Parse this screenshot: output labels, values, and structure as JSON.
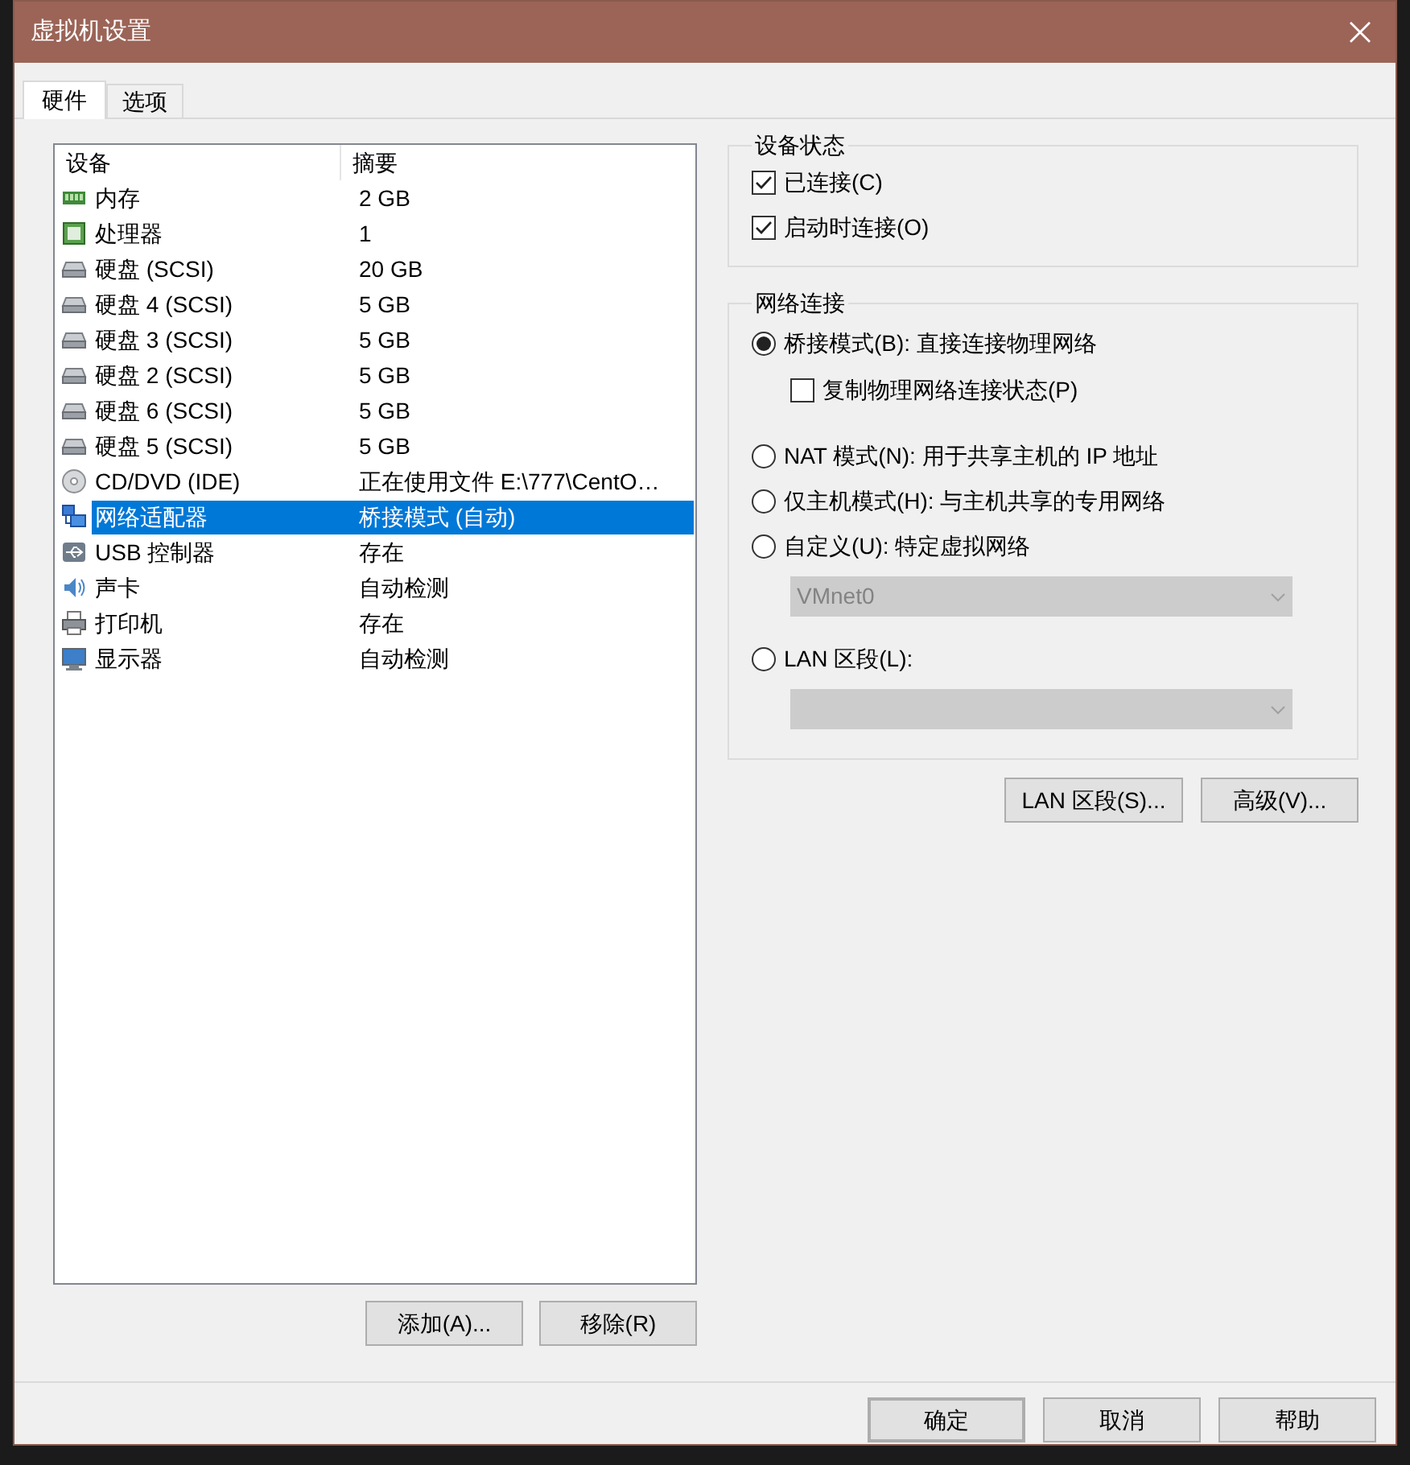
{
  "window": {
    "title": "虚拟机设置"
  },
  "tabs": [
    {
      "label": "硬件",
      "selected": true
    },
    {
      "label": "选项",
      "selected": false
    }
  ],
  "device_table": {
    "columns": [
      "设备",
      "摘要"
    ],
    "rows": [
      {
        "kind": "memory",
        "device": "内存",
        "summary": "2 GB",
        "selected": false
      },
      {
        "kind": "cpu",
        "device": "处理器",
        "summary": "1",
        "selected": false
      },
      {
        "kind": "disk",
        "device": "硬盘 (SCSI)",
        "summary": "20 GB",
        "selected": false
      },
      {
        "kind": "disk",
        "device": "硬盘 4 (SCSI)",
        "summary": "5 GB",
        "selected": false
      },
      {
        "kind": "disk",
        "device": "硬盘 3 (SCSI)",
        "summary": "5 GB",
        "selected": false
      },
      {
        "kind": "disk",
        "device": "硬盘 2 (SCSI)",
        "summary": "5 GB",
        "selected": false
      },
      {
        "kind": "disk",
        "device": "硬盘 6 (SCSI)",
        "summary": "5 GB",
        "selected": false
      },
      {
        "kind": "disk",
        "device": "硬盘 5 (SCSI)",
        "summary": "5 GB",
        "selected": false
      },
      {
        "kind": "cd",
        "device": "CD/DVD (IDE)",
        "summary": "正在使用文件 E:\\777\\CentO…",
        "selected": false
      },
      {
        "kind": "network",
        "device": "网络适配器",
        "summary": "桥接模式 (自动)",
        "selected": true
      },
      {
        "kind": "usb",
        "device": "USB 控制器",
        "summary": "存在",
        "selected": false
      },
      {
        "kind": "sound",
        "device": "声卡",
        "summary": "自动检测",
        "selected": false
      },
      {
        "kind": "printer",
        "device": "打印机",
        "summary": "存在",
        "selected": false
      },
      {
        "kind": "monitor",
        "device": "显示器",
        "summary": "自动检测",
        "selected": false
      }
    ]
  },
  "list_buttons": [
    "添加(A)...",
    "移除(R)"
  ],
  "device_status": {
    "title": "设备状态",
    "checkboxes": [
      {
        "label": "已连接(C)",
        "checked": true
      },
      {
        "label": "启动时连接(O)",
        "checked": true
      }
    ]
  },
  "network_connection": {
    "title": "网络连接",
    "items": [
      {
        "kind": "radio",
        "label": "桥接模式(B): 直接连接物理网络",
        "selected": true
      },
      {
        "kind": "checkbox",
        "label": "复制物理网络连接状态(P)",
        "checked": false
      },
      {
        "kind": "radio",
        "label": "NAT 模式(N): 用于共享主机的 IP 地址",
        "selected": false
      },
      {
        "kind": "radio",
        "label": "仅主机模式(H): 与主机共享的专用网络",
        "selected": false
      },
      {
        "kind": "radio",
        "label": "自定义(U): 特定虚拟网络",
        "selected": false
      },
      {
        "kind": "select",
        "value": "VMnet0",
        "disabled": true
      },
      {
        "kind": "radio",
        "label": "LAN 区段(L):",
        "selected": false
      },
      {
        "kind": "select",
        "disabled": true
      }
    ]
  },
  "network_buttons": [
    "LAN 区段(S)...",
    "高级(V)..."
  ],
  "dialog_buttons": [
    {
      "label": "确定",
      "default": true
    },
    {
      "label": "取消",
      "default": false
    },
    {
      "label": "帮助",
      "default": false
    }
  ]
}
